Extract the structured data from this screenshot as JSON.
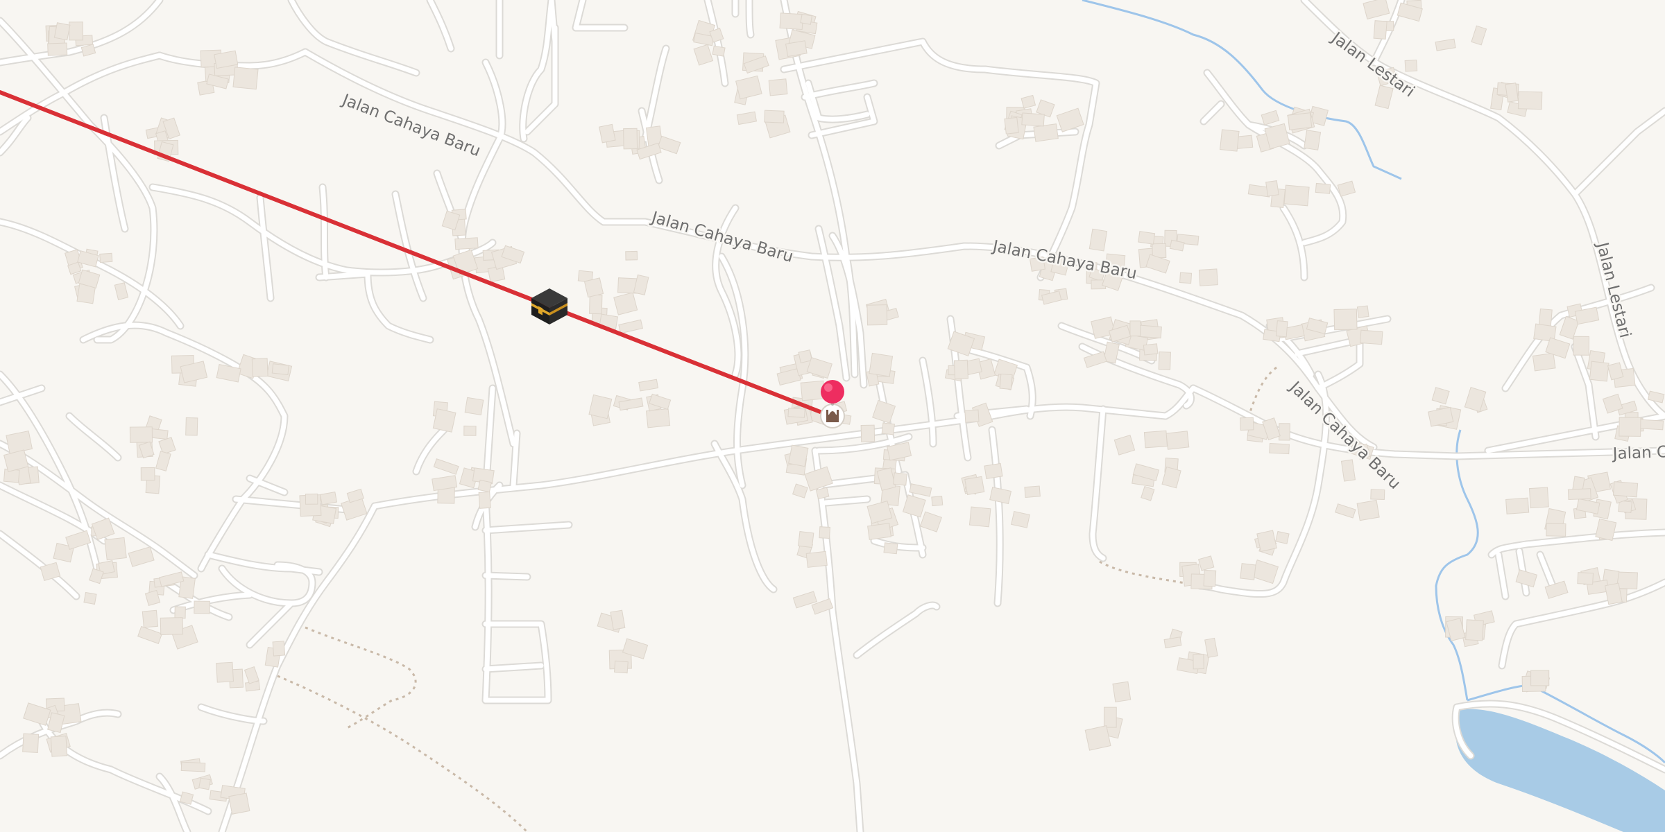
{
  "map": {
    "colors": {
      "land": "#f8f6f2",
      "road_casing": "#dcdad6",
      "road_fill": "#ffffff",
      "building": "#ece6de",
      "water": "#a8cbe6",
      "stream": "#9ec5ea",
      "qibla_line": "#d93036",
      "pin": "#ee2d60"
    },
    "street_labels": [
      {
        "text": "Jalan Cahaya Baru"
      },
      {
        "text": "Jalan Cahaya Baru"
      },
      {
        "text": "Jalan Cahaya Baru"
      },
      {
        "text": "Jalan Cahaya Baru"
      },
      {
        "text": "Jalan Lestari"
      },
      {
        "text": "Jalan Lestari"
      },
      {
        "text": "Jalan C"
      }
    ],
    "markers": {
      "kaaba": {
        "icon": "kaaba-icon"
      },
      "location_pin": {
        "icon": "map-pin-icon"
      },
      "mosque": {
        "icon": "mosque-icon"
      }
    }
  }
}
